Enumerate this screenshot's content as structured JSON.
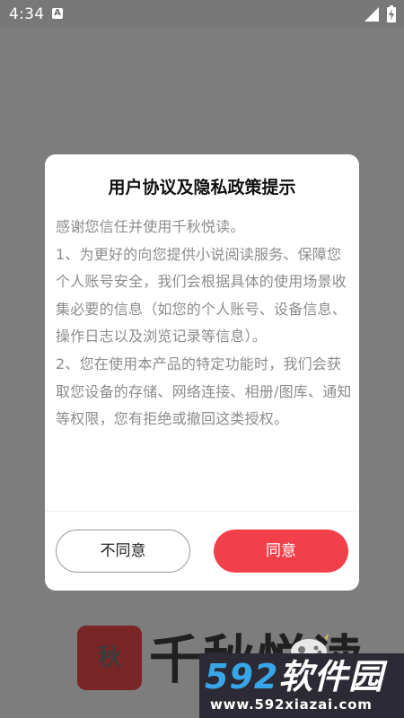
{
  "status_bar": {
    "time": "4:34",
    "notification_icon": "A"
  },
  "background": {
    "logo_char": "秋",
    "app_name": "千秋悦读"
  },
  "dialog": {
    "title": "用户协议及隐私政策提示",
    "paragraphs": [
      "感谢您信任并使用千秋悦读。",
      "1、为更好的向您提供小说阅读服务、保障您个人账号安全，我们会根据具体的使用场景收集必要的信息（如您的个人账号、设备信息、操作日志以及浏览记录等信息）。",
      "2、您在使用本产品的特定功能时，我们会获取您设备的存储、网络连接、相册/图库、通知等权限，您有拒绝或撤回这类授权。"
    ],
    "disagree_label": "不同意",
    "agree_label": "同意"
  },
  "watermark": {
    "number": "592",
    "text": "软件园",
    "url": "www.592xiazai.com"
  },
  "colors": {
    "accent": "#f2404a",
    "overlay": "#7d7d7d",
    "watermark_blue": "#37a6e8"
  }
}
